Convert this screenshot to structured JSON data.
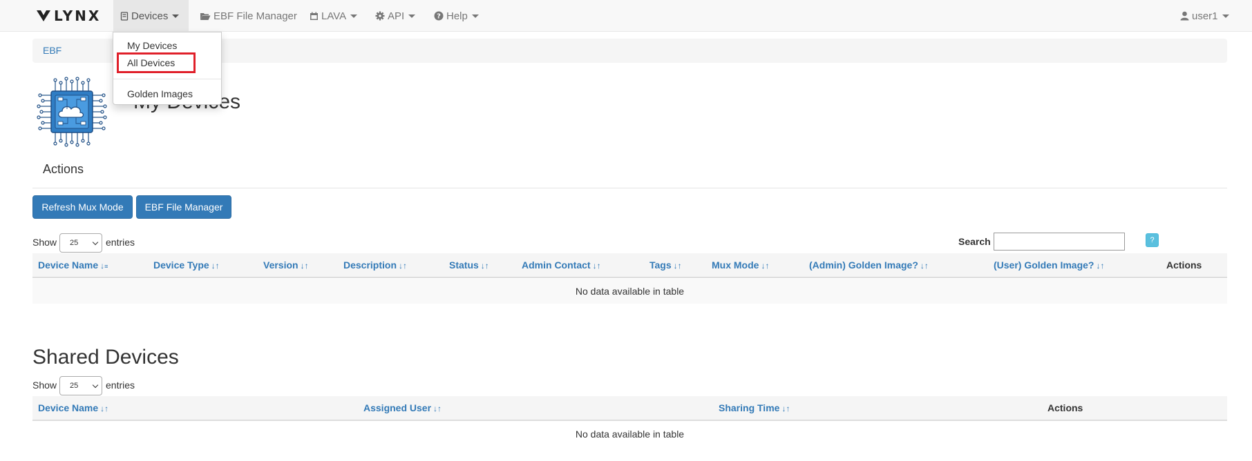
{
  "navbar": {
    "brand": "LYNX",
    "devices": "Devices",
    "ebf_file_manager": "EBF File Manager",
    "lava": "LAVA",
    "api": "API",
    "help": "Help",
    "user": "user1"
  },
  "dropdown": {
    "my_devices": "My Devices",
    "all_devices": "All Devices",
    "golden_images": "Golden Images"
  },
  "breadcrumb": {
    "item": "EBF"
  },
  "page": {
    "title": "My Devices",
    "actions_heading": "Actions",
    "refresh_button": "Refresh Mux Mode",
    "ebf_button": "EBF File Manager"
  },
  "my_devices_table": {
    "show_label": "Show",
    "entries_label": "entries",
    "page_size": "25",
    "search_label": "Search",
    "search_value": "",
    "help_label": "?",
    "columns": [
      "Device Name",
      "Device Type",
      "Version",
      "Description",
      "Status",
      "Admin Contact",
      "Tags",
      "Mux Mode",
      "(Admin) Golden Image?",
      "(User) Golden Image?",
      "Actions"
    ],
    "empty_message": "No data available in table"
  },
  "shared_devices": {
    "title": "Shared Devices",
    "show_label": "Show",
    "entries_label": "entries",
    "page_size": "25",
    "columns": [
      "Device Name",
      "Assigned User",
      "Sharing Time",
      "Actions"
    ],
    "empty_message": "No data available in table"
  },
  "colors": {
    "primary": "#337ab7",
    "highlight": "#e0202a",
    "info": "#5bc0de"
  }
}
